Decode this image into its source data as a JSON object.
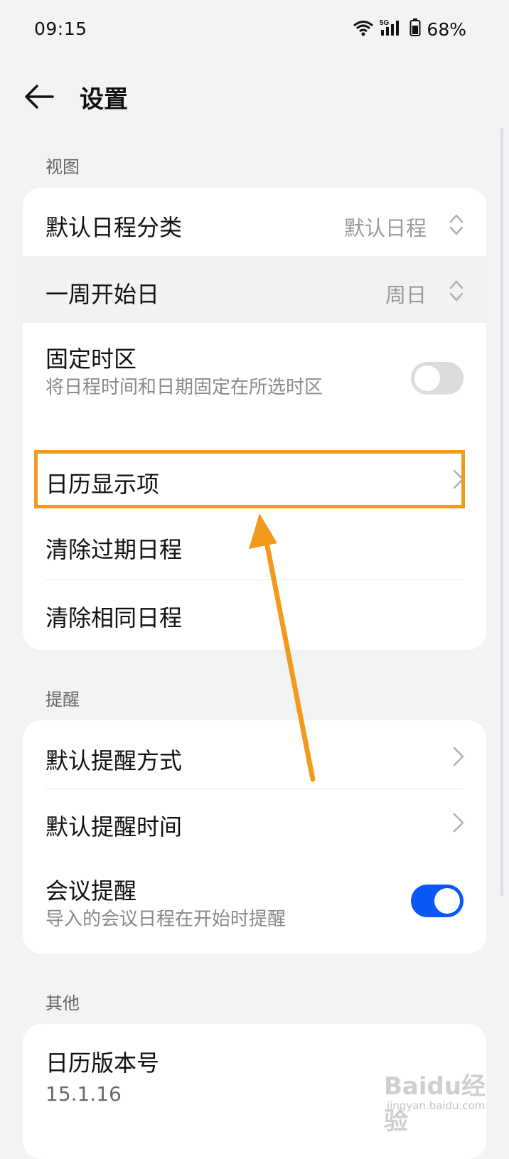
{
  "status_bar": {
    "time": "09:15",
    "network": "5G",
    "battery": "68%"
  },
  "header": {
    "title": "设置"
  },
  "sections": {
    "view": {
      "label": "视图",
      "items": {
        "default_category": {
          "title": "默认日程分类",
          "value": "默认日程"
        },
        "week_start": {
          "title": "一周开始日",
          "value": "周日"
        },
        "fixed_timezone": {
          "title": "固定时区",
          "subtitle": "将日程时间和日期固定在所选时区",
          "toggle": false
        },
        "calendar_display": {
          "title": "日历显示项"
        },
        "clear_expired": {
          "title": "清除过期日程"
        },
        "clear_duplicate": {
          "title": "清除相同日程"
        }
      }
    },
    "reminder": {
      "label": "提醒",
      "items": {
        "default_method": {
          "title": "默认提醒方式"
        },
        "default_time": {
          "title": "默认提醒时间"
        },
        "meeting": {
          "title": "会议提醒",
          "subtitle": "导入的会议日程在开始时提醒",
          "toggle": true
        }
      }
    },
    "other": {
      "label": "其他",
      "items": {
        "version": {
          "title": "日历版本号",
          "value": "15.1.16"
        }
      }
    }
  },
  "watermark": {
    "main": "Baidu经验",
    "sub": "jingyan.baidu.com"
  },
  "colors": {
    "accent": "#0a59f7",
    "annotation": "#f39a1d",
    "background": "#f1f3f5"
  }
}
